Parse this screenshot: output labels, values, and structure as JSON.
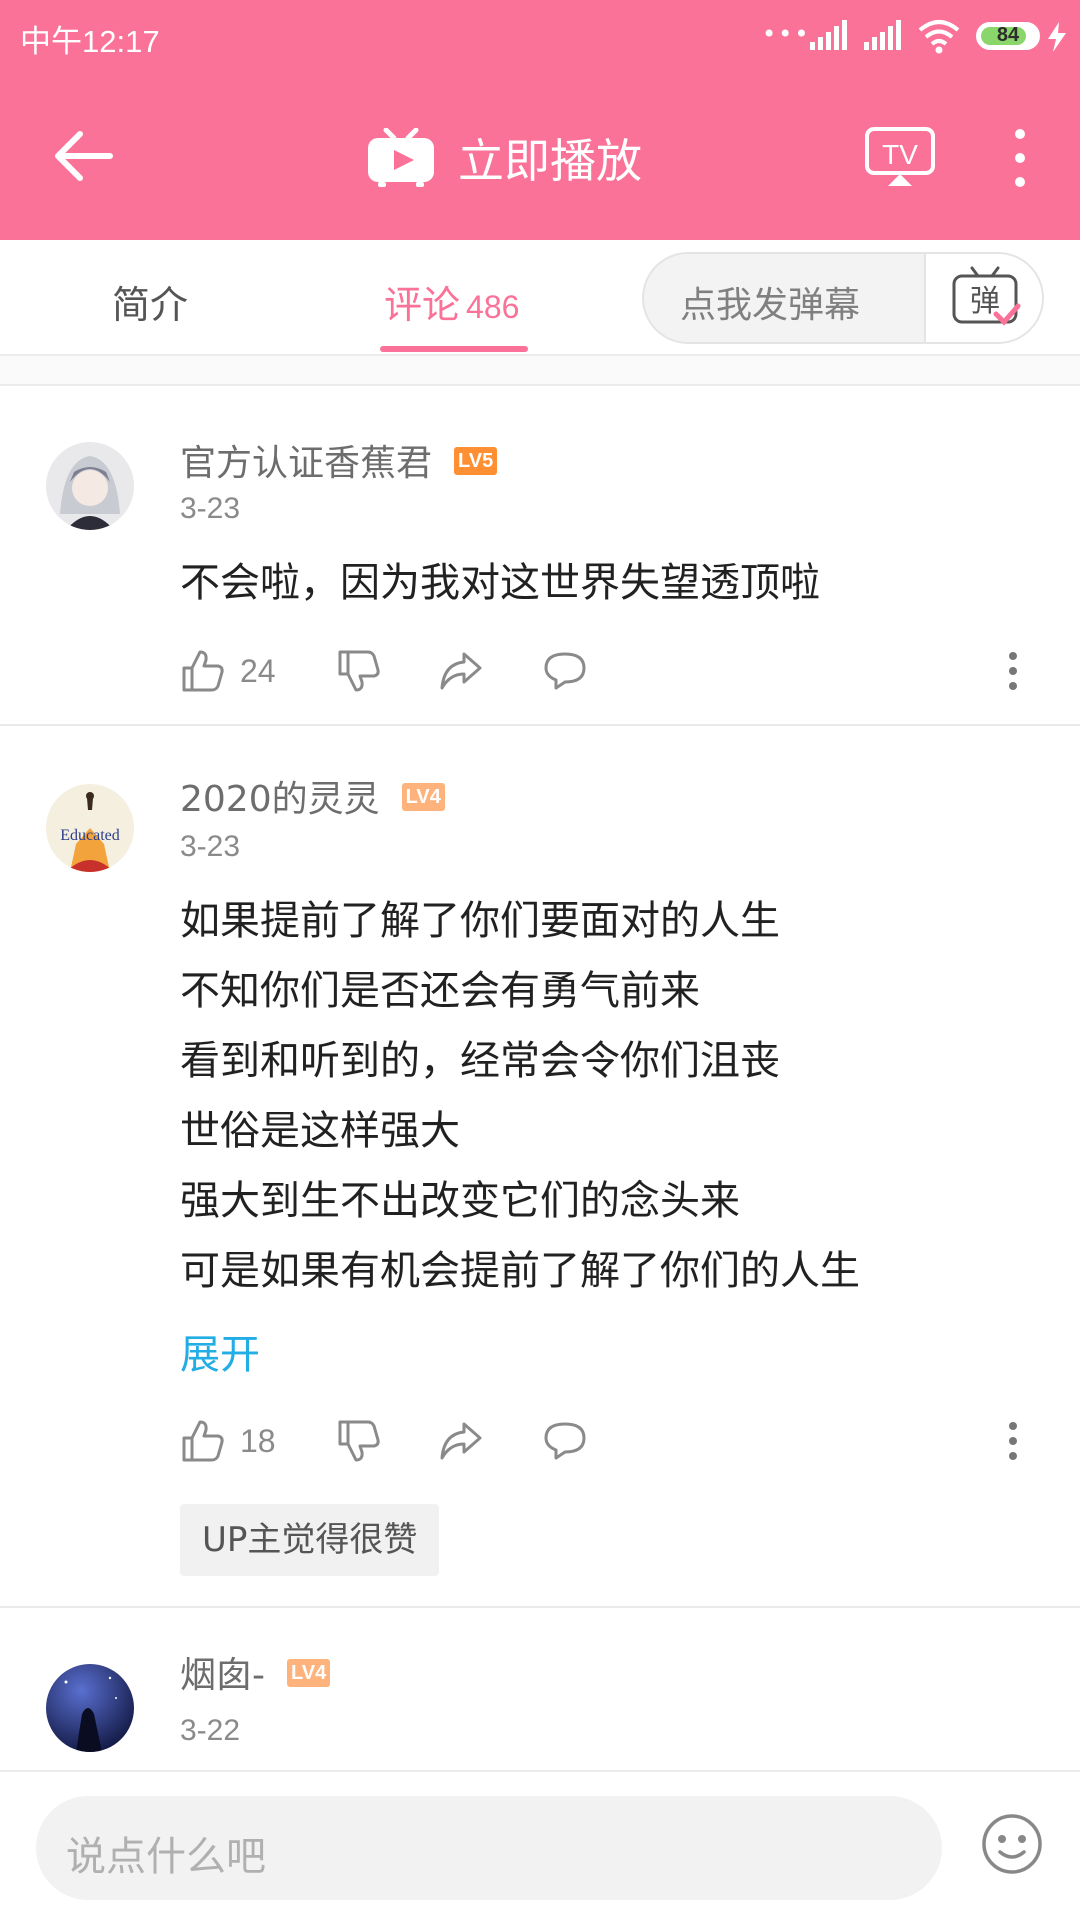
{
  "status_bar": {
    "time": "中午12:17",
    "dots": "•••",
    "battery": "84",
    "battery_level": 0.84
  },
  "toolbar": {
    "title": "立即播放",
    "icons": [
      "back-arrow-icon",
      "tv-play-icon",
      "tv-cast-icon",
      "more-vert-icon"
    ]
  },
  "tabs": {
    "intro_label": "简介",
    "comments_label": "评论",
    "comments_count": "486",
    "danmaku_placeholder": "点我发弹幕",
    "danmaku_button_glyph": "弹"
  },
  "comments": [
    {
      "username": "官方认证香蕉君",
      "level": "LV5",
      "date": "3-23",
      "text": "不会啦，因为我对这世界失望透顶啦",
      "likes": "24"
    },
    {
      "username": "2020的灵灵",
      "level": "LV4",
      "date": "3-23",
      "avatar_text": "Educated",
      "lines": [
        "如果提前了解了你们要面对的人生",
        "不知你们是否还会有勇气前来",
        "看到和听到的，经常会令你们沮丧",
        "世俗是这样强大",
        "强大到生不出改变它们的念头来",
        "可是如果有机会提前了解了你们的人生"
      ],
      "expand_label": "展开",
      "likes": "18",
      "up_badge": "UP主觉得很赞"
    },
    {
      "username": "烟囱-",
      "level": "LV4",
      "date": "3-22"
    }
  ],
  "bottom": {
    "placeholder": "说点什么吧"
  },
  "colors": {
    "brand_pink": "#fb7299",
    "link_blue": "#23ade5",
    "lv5": "#ff8f33",
    "lv4": "#ffb37c"
  }
}
